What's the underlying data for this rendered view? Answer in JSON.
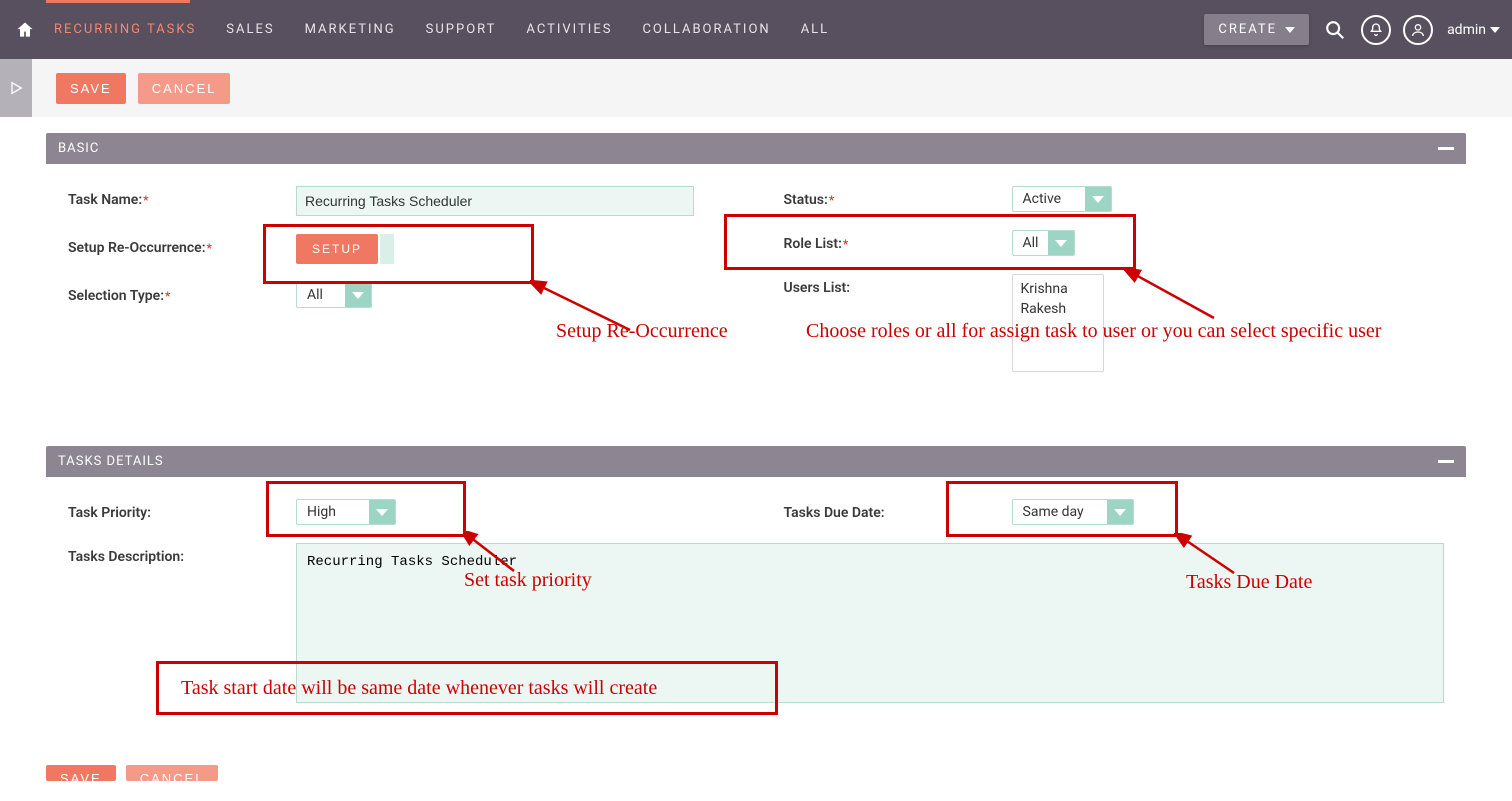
{
  "topbar": {
    "nav": [
      "RECURRING TASKS",
      "SALES",
      "MARKETING",
      "SUPPORT",
      "ACTIVITIES",
      "COLLABORATION",
      "ALL"
    ],
    "active_index": 0,
    "create_label": "CREATE",
    "user_label": "admin"
  },
  "actions": {
    "save": "SAVE",
    "cancel": "CANCEL"
  },
  "basic": {
    "title": "BASIC",
    "labels": {
      "task_name": "Task Name:",
      "setup_reocc": "Setup Re-Occurrence:",
      "selection_type": "Selection Type:",
      "status": "Status:",
      "role_list": "Role List:",
      "users_list": "Users List:"
    },
    "task_name_value": "Recurring Tasks Scheduler",
    "setup_btn": "SETUP",
    "selection_type_value": "All",
    "status_value": "Active",
    "role_list_value": "All",
    "users": [
      "Krishna",
      "Rakesh"
    ]
  },
  "details": {
    "title": "TASKS DETAILS",
    "labels": {
      "priority": "Task Priority:",
      "due_date": "Tasks Due Date:",
      "description": "Tasks Description:"
    },
    "priority_value": "High",
    "due_date_value": "Same day",
    "description_value": "Recurring Tasks Scheduler"
  },
  "annotations": {
    "setup": "Setup Re-Occurrence",
    "roles": "Choose roles or all for assign task to user or you can select specific user",
    "priority": "Set task priority",
    "due": "Tasks Due Date",
    "startdate": "Task start date will be same date whenever tasks will create"
  }
}
